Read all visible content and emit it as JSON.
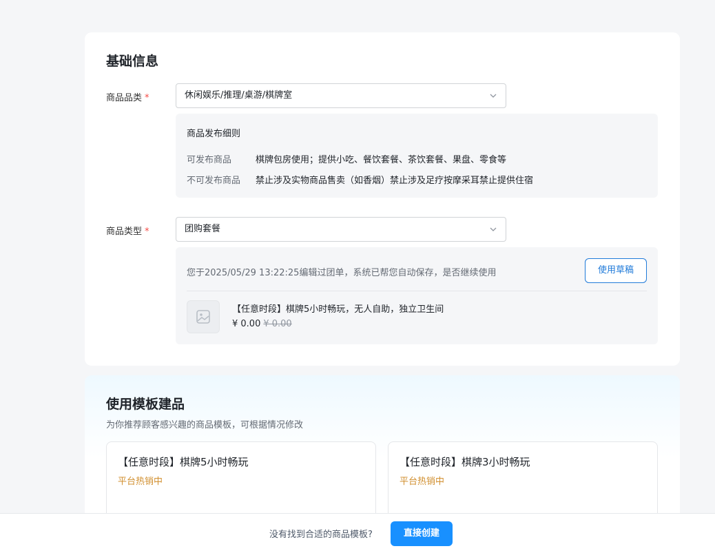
{
  "basic": {
    "title": "基础信息",
    "category_label": "商品品类",
    "category_value": "休闲娱乐/推理/桌游/棋牌室",
    "rules": {
      "title": "商品发布细则",
      "allowed_key": "可发布商品",
      "allowed_value": "棋牌包房使用；提供小吃、餐饮套餐、茶饮套餐、果盘、零食等",
      "forbidden_key": "不可发布商品",
      "forbidden_value": "禁止涉及实物商品售卖（如香烟）禁止涉及足疗按摩采耳禁止提供住宿"
    },
    "type_label": "商品类型",
    "type_value": "团购套餐",
    "required_mark": "*",
    "draft": {
      "message": "您于2025/05/29 13:22:25编辑过团单，系统已帮您自动保存，是否继续使用",
      "button": "使用草稿",
      "product_name": "【任意时段】棋牌5小时畅玩，无人自助，独立卫生间",
      "price": "¥ 0.00",
      "original_price": "¥ 0.00"
    }
  },
  "templates": {
    "title": "使用模板建品",
    "subtitle": "为你推荐顾客感兴趣的商品模板，可根据情况修改",
    "items": [
      {
        "title": "【任意时段】棋牌5小时畅玩",
        "tag": "平台热销中"
      },
      {
        "title": "【任意时段】棋牌3小时畅玩",
        "tag": "平台热销中"
      }
    ]
  },
  "footer": {
    "text": "没有找到合适的商品模板?",
    "button": "直接创建"
  },
  "colors": {
    "accent": "#1890ff",
    "required": "#f54a45",
    "hot_tag": "#d18f2f"
  },
  "icons": [
    "chevron-down-icon",
    "image-placeholder-icon"
  ]
}
